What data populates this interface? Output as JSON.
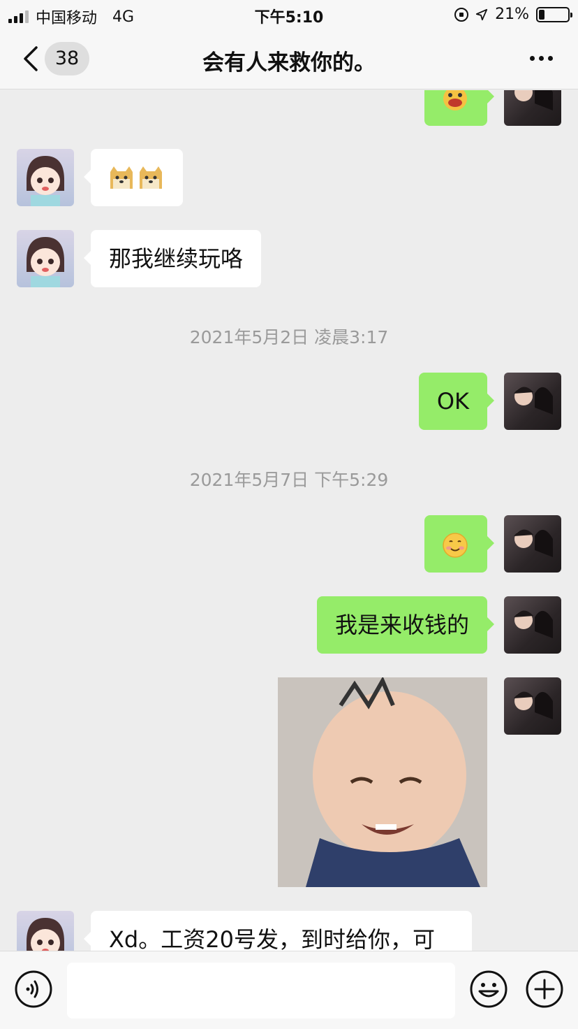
{
  "status_bar": {
    "carrier": "中国移动",
    "network": "4G",
    "time": "下午5:10",
    "battery_percent": "21%",
    "battery_level": 0.21
  },
  "nav": {
    "back_icon": "chevron-left-icon",
    "unread_count": "38",
    "title": "会有人来救你的。",
    "more_icon": "more-dots-icon"
  },
  "messages": [
    {
      "from": "me",
      "type": "sticker",
      "icon": "grin-sticker-icon"
    },
    {
      "from": "them",
      "type": "sticker",
      "icon": "doge-face-icons"
    },
    {
      "from": "them",
      "type": "text",
      "text": "那我继续玩咯"
    },
    {
      "type": "timestamp",
      "text": "2021年5月2日 凌晨3:17"
    },
    {
      "from": "me",
      "type": "text",
      "text": "OK"
    },
    {
      "type": "timestamp",
      "text": "2021年5月7日 下午5:29"
    },
    {
      "from": "me",
      "type": "emoji",
      "icon": "smile-emoji-icon"
    },
    {
      "from": "me",
      "type": "text",
      "text": "我是来收钱的"
    },
    {
      "from": "me",
      "type": "image",
      "icon": "baby-meme-image"
    },
    {
      "from": "them",
      "type": "text",
      "text": "Xd。工资20号发，到时给你，可"
    }
  ],
  "input_bar": {
    "voice_icon": "voice-icon",
    "emoji_icon": "emoji-icon",
    "plus_icon": "plus-icon",
    "placeholder": ""
  },
  "colors": {
    "chat_background": "#ededed",
    "outgoing_bubble": "#95ec69",
    "incoming_bubble": "#ffffff",
    "bar_background": "#f7f7f7"
  }
}
